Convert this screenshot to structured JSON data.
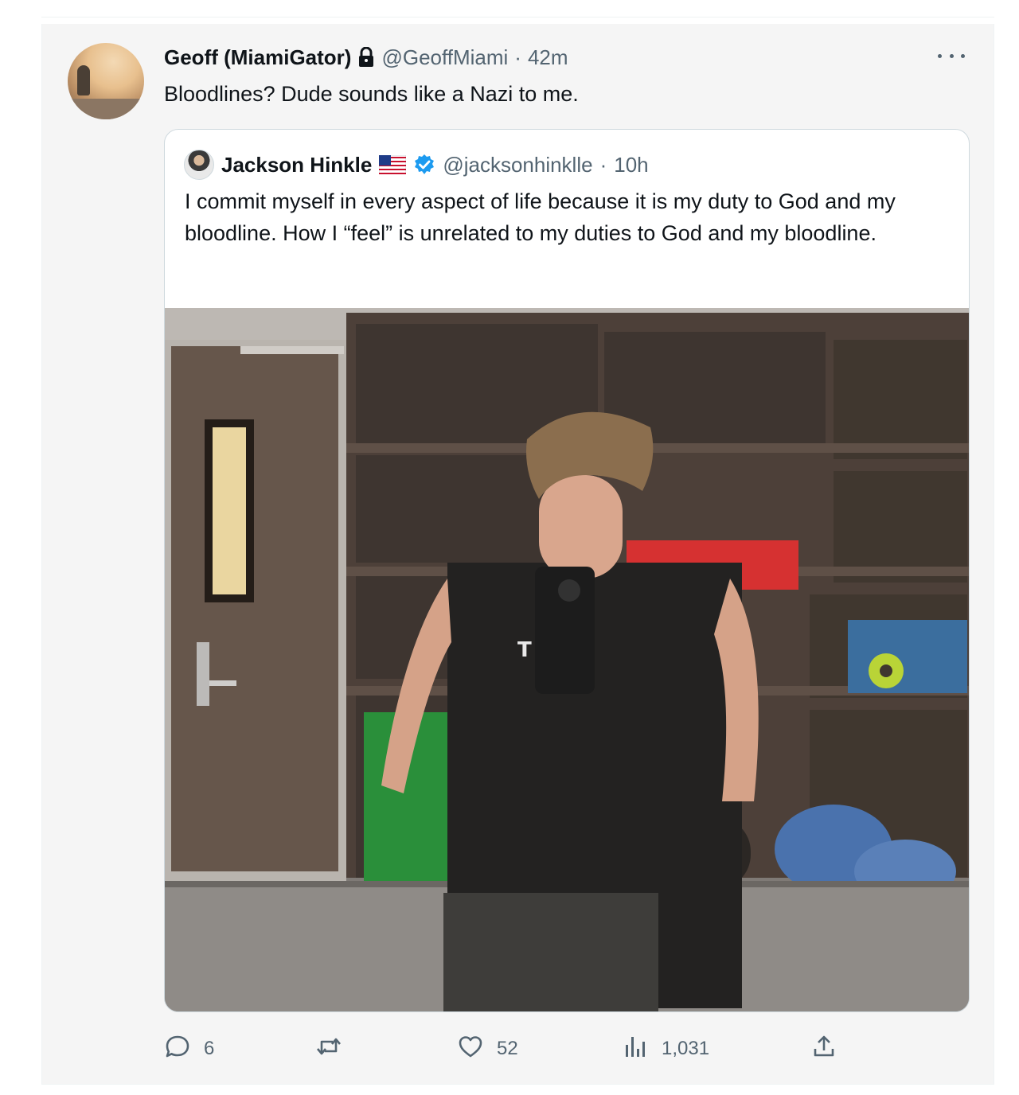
{
  "tweet": {
    "author": {
      "display_name": "Geoff (MiamiGator)",
      "handle": "@GeoffMiami",
      "separator": "·",
      "time": "42m",
      "avatar_icon": "profile-photo-sunset"
    },
    "text": "Bloodlines? Dude sounds like a Nazi to me.",
    "more_icon": "more-horizontal-icon"
  },
  "quoted": {
    "author": {
      "display_name": "Jackson Hinkle",
      "flag_icon": "us-flag-icon",
      "verified_icon": "verified-badge-icon",
      "handle": "@jacksonhinklle",
      "separator": "·",
      "time": "10h"
    },
    "text": "I commit myself in every aspect of life because it is my duty to God and my bloodline. How I “feel” is unrelated to my duties to God and my bloodline.",
    "media": "mirror-selfie-photo",
    "shirt_text": "T"
  },
  "actions": {
    "reply_count": "6",
    "retweet_count": "",
    "like_count": "52",
    "views_count": "1,031"
  },
  "colors": {
    "text_primary": "#0f1419",
    "text_secondary": "#536471",
    "border": "#cfd9de",
    "verified_blue": "#1d9bf0"
  }
}
